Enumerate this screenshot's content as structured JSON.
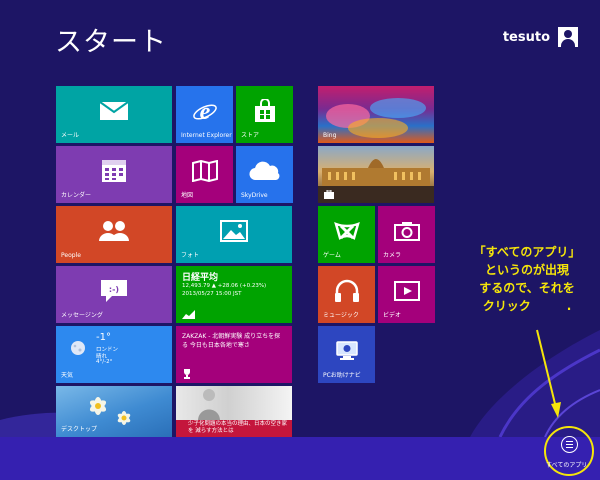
{
  "header": {
    "title": "スタート",
    "user_name": "tesuto"
  },
  "tiles": {
    "mail": {
      "label": "メール",
      "icon": "envelope-icon",
      "color": "#00a4a4"
    },
    "ie": {
      "label": "Internet Explorer",
      "icon": "internet-explorer-icon",
      "color": "#2673ec"
    },
    "store": {
      "label": "ストア",
      "icon": "shopping-bag-icon",
      "color": "#00a300"
    },
    "calendar": {
      "label": "カレンダー",
      "icon": "calendar-icon",
      "color": "#7e3cb1"
    },
    "maps": {
      "label": "地図",
      "icon": "map-icon",
      "color": "#a4007b"
    },
    "skydrive": {
      "label": "SkyDrive",
      "icon": "cloud-icon",
      "color": "#2672ec"
    },
    "people": {
      "label": "People",
      "icon": "people-icon",
      "color": "#d24726"
    },
    "photos": {
      "label": "フォト",
      "icon": "picture-icon",
      "color": "#00a0b1"
    },
    "finance": {
      "label": "日経平均",
      "value": "12,493.79 ▲ +28.06 (+0.23%)",
      "timestamp": "2013/05/27 15:00 JST",
      "icon": "chart-icon",
      "color": "#00a300"
    },
    "messaging": {
      "label": "メッセージング",
      "icon": "chat-icon",
      "color": "#7e3cb1"
    },
    "weather": {
      "temp": "-1°",
      "city": "ロンドン",
      "condition": "晴れ",
      "range": "4°/-2°",
      "label": "天気",
      "color": "#2d89ef"
    },
    "news": {
      "headline": "ZAKZAK - 北朝鮮実験 成り立ちを探る 今日も日本各地で寒さ",
      "label": "",
      "icon": "trophy-icon",
      "color": "#a4007b"
    },
    "desktop": {
      "label": "デスクトップ",
      "color": "#4aa0d8"
    },
    "news2": {
      "headline": "少子化問題の本当の理由、日本の空き家を 減らす方法とは",
      "color": "#c4163c"
    },
    "bing": {
      "label": "Bing",
      "color": "#6a2a6a"
    },
    "travel": {
      "label": "",
      "icon": "suitcase-icon",
      "color": "#8a6a3a"
    },
    "games": {
      "label": "ゲーム",
      "icon": "xbox-icon",
      "color": "#00a300"
    },
    "camera": {
      "label": "カメラ",
      "icon": "camera-icon",
      "color": "#a4007b"
    },
    "music": {
      "label": "ミュージック",
      "icon": "headphones-icon",
      "color": "#d24726"
    },
    "video": {
      "label": "ビデオ",
      "icon": "play-icon",
      "color": "#a4007b"
    },
    "pc_settings": {
      "label": "PCお助けナビ",
      "icon": "pc-icon",
      "color": "#2d46c0"
    }
  },
  "annotation": {
    "lines": [
      "「すべてのアプリ」",
      "というのが出現",
      "するので、それを",
      "クリック　　　."
    ],
    "color": "#f5e50a"
  },
  "all_apps": {
    "label": "すべてのアプリ",
    "icon": "all-apps-icon"
  }
}
